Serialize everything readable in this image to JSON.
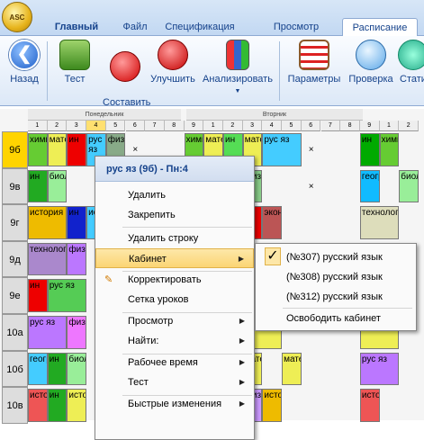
{
  "app_button_label": "ASC",
  "tabs": [
    {
      "label": "Главный"
    },
    {
      "label": "Файл"
    },
    {
      "label": "Спецификация"
    },
    {
      "label": "Просмотр"
    },
    {
      "label": "Расписание"
    }
  ],
  "ribbon": {
    "back": "Назад",
    "test": "Тест",
    "compose_new": "Составить\nновое",
    "improve": "Улучшить",
    "analyze": "Анализировать",
    "params": "Параметры",
    "check": "Проверка",
    "stats": "Стати"
  },
  "grid": {
    "day1": "Понедельник",
    "day2": "Вторник",
    "periods": [
      "1",
      "2",
      "3",
      "4",
      "5",
      "6",
      "7",
      "8",
      "9",
      "1",
      "2",
      "3",
      "4",
      "5",
      "6",
      "7",
      "8",
      "9",
      "1",
      "2"
    ],
    "rows": [
      "9б",
      "9в",
      "9г",
      "9д",
      "9е",
      "10а",
      "10б",
      "10в"
    ],
    "row9b_sub": "2",
    "cell_texts": {
      "chem": "химия",
      "math": "матем",
      "in": "ин",
      "rus": "рус яз",
      "phys": "физика",
      "bio": "биология",
      "hist": "история",
      "tech": "технология",
      "econ": "эконом",
      "geog": "география",
      "x": "×"
    }
  },
  "context_menu": {
    "title": "рус яз (9б) - Пн:4",
    "items": {
      "delete": "Удалить",
      "pin": "Закрепить",
      "delete_row": "Удалить строку",
      "cabinet": "Кабинет",
      "correct": "Корректировать",
      "lesson_grid": "Сетка уроков",
      "view": "Просмотр",
      "find": "Найти:",
      "work_time": "Рабочее время",
      "test": "Тест",
      "quick_changes": "Быстрые изменения"
    }
  },
  "submenu": {
    "items": [
      "(№307) русский язык",
      "(№308) русский язык",
      "(№312) русский язык"
    ],
    "free": "Освободить кабинет",
    "check": "✓"
  }
}
